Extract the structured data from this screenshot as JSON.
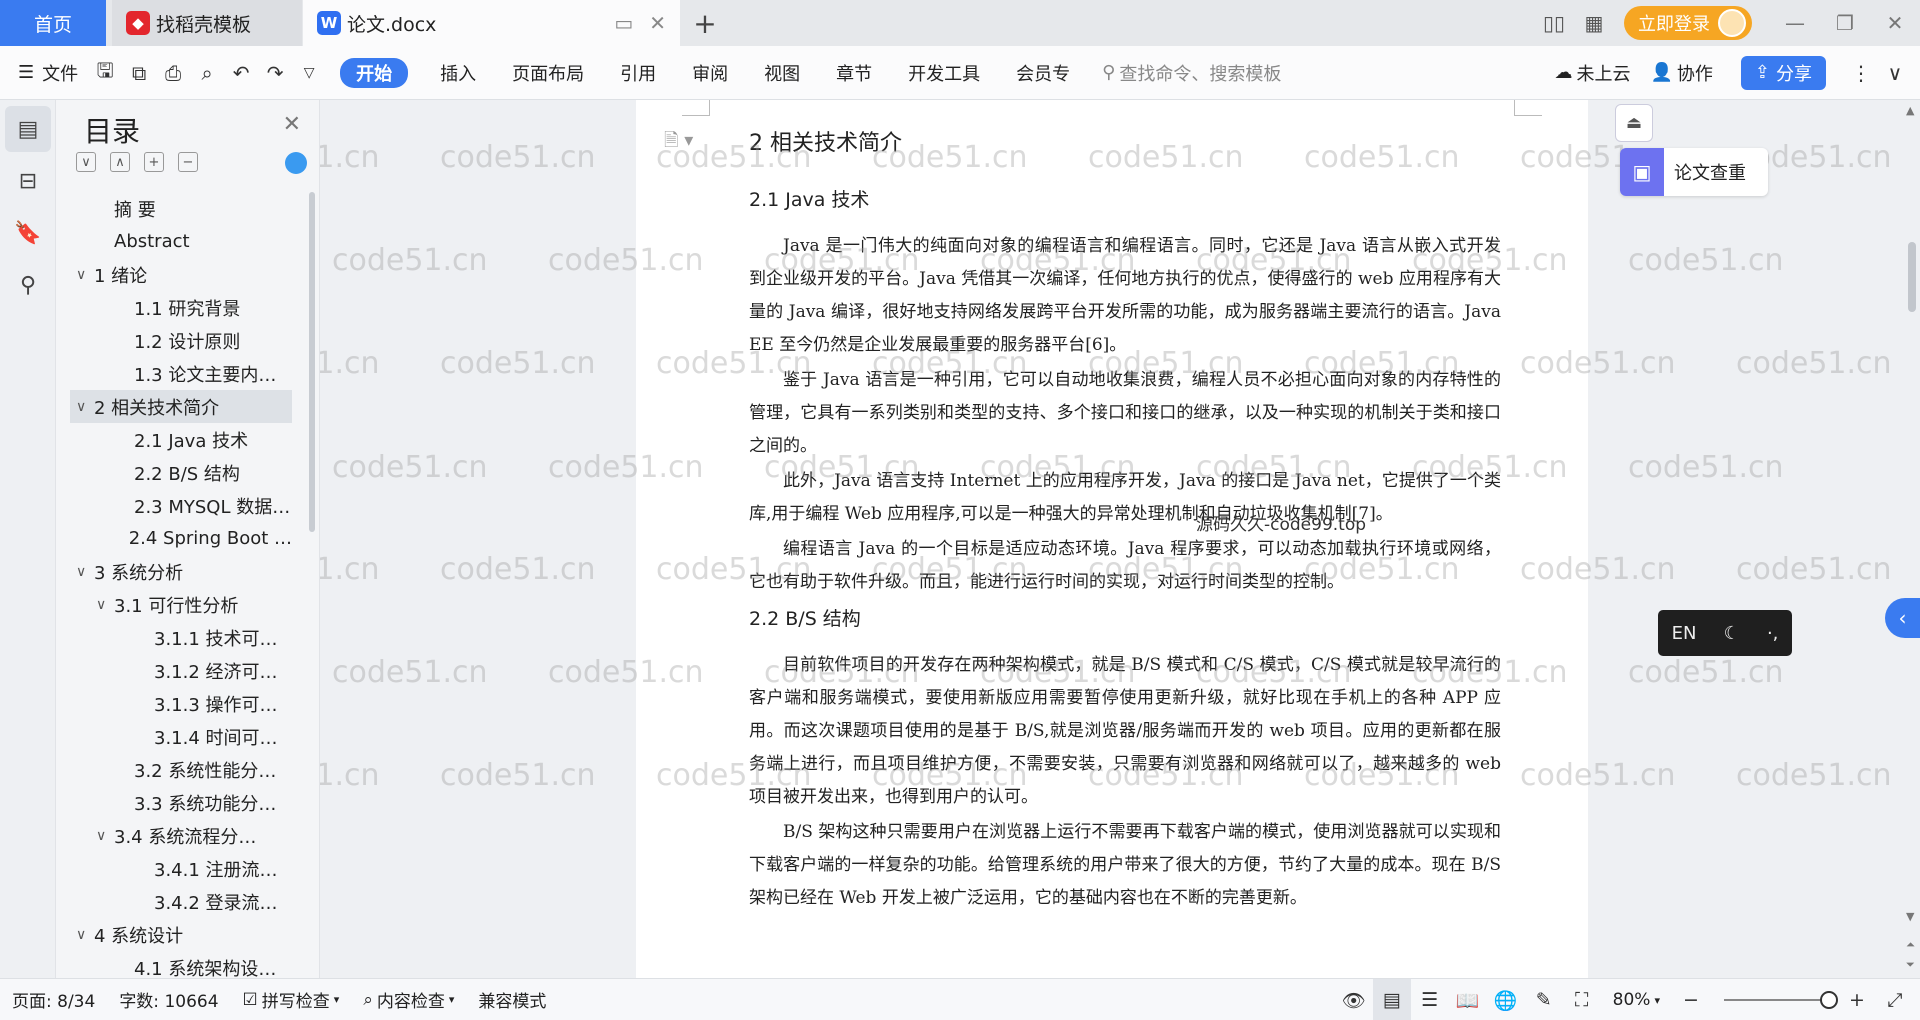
{
  "titlebar": {
    "home_tab": "首页",
    "templates_tab": "找稻壳模板",
    "doc_tab": "论文.docx",
    "login": "立即登录"
  },
  "ribbon": {
    "file": "文件",
    "tabs": [
      "开始",
      "插入",
      "页面布局",
      "引用",
      "审阅",
      "视图",
      "章节",
      "开发工具",
      "会员专"
    ],
    "search_placeholder": "查找命令、搜索模板",
    "cloud": "未上云",
    "collab": "协作",
    "share": "分享"
  },
  "toc": {
    "title": "目录",
    "items": [
      {
        "label": "摘  要",
        "level": 1,
        "caret": ""
      },
      {
        "label": "Abstract",
        "level": 1,
        "caret": ""
      },
      {
        "label": "1  绪论",
        "level": 0,
        "caret": "∨"
      },
      {
        "label": "1.1 研究背景",
        "level": 2,
        "caret": ""
      },
      {
        "label": "1.2 设计原则",
        "level": 2,
        "caret": ""
      },
      {
        "label": "1.3 论文主要内…",
        "level": 2,
        "caret": ""
      },
      {
        "label": "2  相关技术简介",
        "level": 0,
        "caret": "∨"
      },
      {
        "label": "2.1 Java 技术",
        "level": 2,
        "caret": ""
      },
      {
        "label": "2.2 B/S 结构",
        "level": 2,
        "caret": ""
      },
      {
        "label": "2.3 MYSQL 数据…",
        "level": 2,
        "caret": ""
      },
      {
        "label": "2.4 Spring Boot …",
        "level": 2,
        "caret": ""
      },
      {
        "label": "3  系统分析",
        "level": 0,
        "caret": "∨"
      },
      {
        "label": "3.1  可行性分析",
        "level": 1,
        "caret": "∨"
      },
      {
        "label": "3.1.1  技术可…",
        "level": 3,
        "caret": ""
      },
      {
        "label": "3.1.2  经济可…",
        "level": 3,
        "caret": ""
      },
      {
        "label": "3.1.3  操作可…",
        "level": 3,
        "caret": ""
      },
      {
        "label": "3.1.4  时间可…",
        "level": 3,
        "caret": ""
      },
      {
        "label": "3.2  系统性能分…",
        "level": 2,
        "caret": ""
      },
      {
        "label": "3.3  系统功能分…",
        "level": 2,
        "caret": ""
      },
      {
        "label": "3.4  系统流程分…",
        "level": 1,
        "caret": "∨"
      },
      {
        "label": "3.4.1  注册流…",
        "level": 3,
        "caret": ""
      },
      {
        "label": "3.4.2  登录流…",
        "level": 3,
        "caret": ""
      },
      {
        "label": "4  系统设计",
        "level": 0,
        "caret": "∨"
      },
      {
        "label": "4.1  系统架构设…",
        "level": 2,
        "caret": ""
      }
    ]
  },
  "document": {
    "heading": "2  相关技术简介",
    "sec1_title": "2.1  Java 技术",
    "sec1_paras": [
      "Java 是一门伟大的纯面向对象的编程语言和编程语言。同时，它还是 Java 语言从嵌入式开发到企业级开发的平台。Java 凭借其一次编译，任何地方执行的优点，使得盛行的 web 应用程序有大量的 Java 编译，很好地支持网络发展跨平台开发所需的功能，成为服务器端主要流行的语言。Java EE 至今仍然是企业发展最重要的服务器平台[6]。",
      "鉴于 Java 语言是一种引用，它可以自动地收集浪费，编程人员不必担心面向对象的内存特性的管理，它具有一系列类别和类型的支持、多个接口和接口的继承，以及一种实现的机制关于类和接口之间的。",
      "此外，Java 语言支持 Internet 上的应用程序开发，Java 的接口是 Java net，它提供了一个类库,用于编程 Web 应用程序,可以是一种强大的异常处理机制和自动垃圾收集机制[7]。",
      "编程语言 Java 的一个目标是适应动态环境。Java 程序要求，可以动态加载执行环境或网络，它也有助于软件升级。而且，能进行运行时间的实现，对运行时间类型的控制。"
    ],
    "sec2_title": "2.2  B/S 结构",
    "sec2_paras": [
      "目前软件项目的开发存在两种架构模式，就是 B/S 模式和 C/S 模式，C/S 模式就是较早流行的客户端和服务端模式，要使用新版应用需要暂停使用更新升级，就好比现在手机上的各种 APP 应用。而这次课题项目使用的是基于 B/S,就是浏览器/服务端而开发的 web 项目。应用的更新都在服务端上进行，而且项目维护方便，不需要安装，只需要有浏览器和网络就可以了，越来越多的 web 项目被开发出来，也得到用户的认可。",
      "B/S 架构这种只需要用户在浏览器上运行不需要再下载客户端的模式，使用浏览器就可以实现和下载客户端的一样复杂的功能。给管理系统的用户带来了很大的方便，节约了大量的成本。现在 B/S 架构已经在 Web 开发上被广泛运用，它的基础内容也在不断的完善更新。"
    ],
    "overlay": "源码久久-code99.top",
    "watermark": "code51.cn"
  },
  "floating": {
    "check": "论文查重",
    "ime_lang": "EN"
  },
  "status": {
    "page": "页面: 8/34",
    "words": "字数: 10664",
    "spell": "拼写检查",
    "content_check": "内容检查",
    "compat": "兼容模式",
    "zoom": "80%"
  }
}
